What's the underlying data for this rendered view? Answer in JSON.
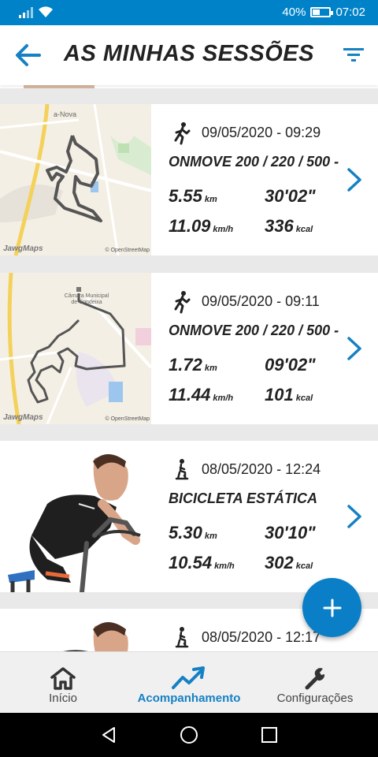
{
  "status_bar": {
    "battery_percent": "40%",
    "battery_level": 0.4,
    "time": "07:02"
  },
  "header": {
    "title": "AS MINHAS SESSÕES",
    "back_icon": "arrow-left-icon",
    "filter_icon": "filter-icon"
  },
  "sessions": [
    {
      "sport_icon": "running-icon",
      "date": "09/05/2020 - 09:29",
      "name": "ONMOVE 200 / 220 / 500 -",
      "distance": "5.55",
      "distance_unit": "km",
      "duration": "30'02\"",
      "speed": "11.09",
      "speed_unit": "km/h",
      "calories": "336",
      "calories_unit": "kcal",
      "map_label": "a-Nova",
      "map_credit_left": "JawgMaps",
      "map_credit_right": "© OpenStreetMap"
    },
    {
      "sport_icon": "running-icon",
      "date": "09/05/2020 - 09:11",
      "name": "ONMOVE 200 / 220 / 500 -",
      "distance": "1.72",
      "distance_unit": "km",
      "duration": "09'02\"",
      "speed": "11.44",
      "speed_unit": "km/h",
      "calories": "101",
      "calories_unit": "kcal",
      "map_label": "Câmara Municipal de Condeixa",
      "map_credit_left": "JawgMaps",
      "map_credit_right": "© OpenStreetMap"
    },
    {
      "sport_icon": "stationary-bike-icon",
      "date": "08/05/2020 - 12:24",
      "name": "BICICLETA ESTÁTICA",
      "distance": "5.30",
      "distance_unit": "km",
      "duration": "30'10\"",
      "speed": "10.54",
      "speed_unit": "km/h",
      "calories": "302",
      "calories_unit": "kcal"
    },
    {
      "sport_icon": "stationary-bike-icon",
      "date": "08/05/2020 - 12:17"
    }
  ],
  "fab": {
    "icon": "plus-icon"
  },
  "bottom_nav": {
    "items": [
      {
        "label": "Início",
        "icon": "home-icon",
        "active": false
      },
      {
        "label": "Acompanhamento",
        "icon": "trend-chart-icon",
        "active": true
      },
      {
        "label": "Configurações",
        "icon": "wrench-icon",
        "active": false
      }
    ]
  },
  "colors": {
    "accent": "#0082c8",
    "active_tab": "#1581c4",
    "fab": "#0a7fc7"
  }
}
